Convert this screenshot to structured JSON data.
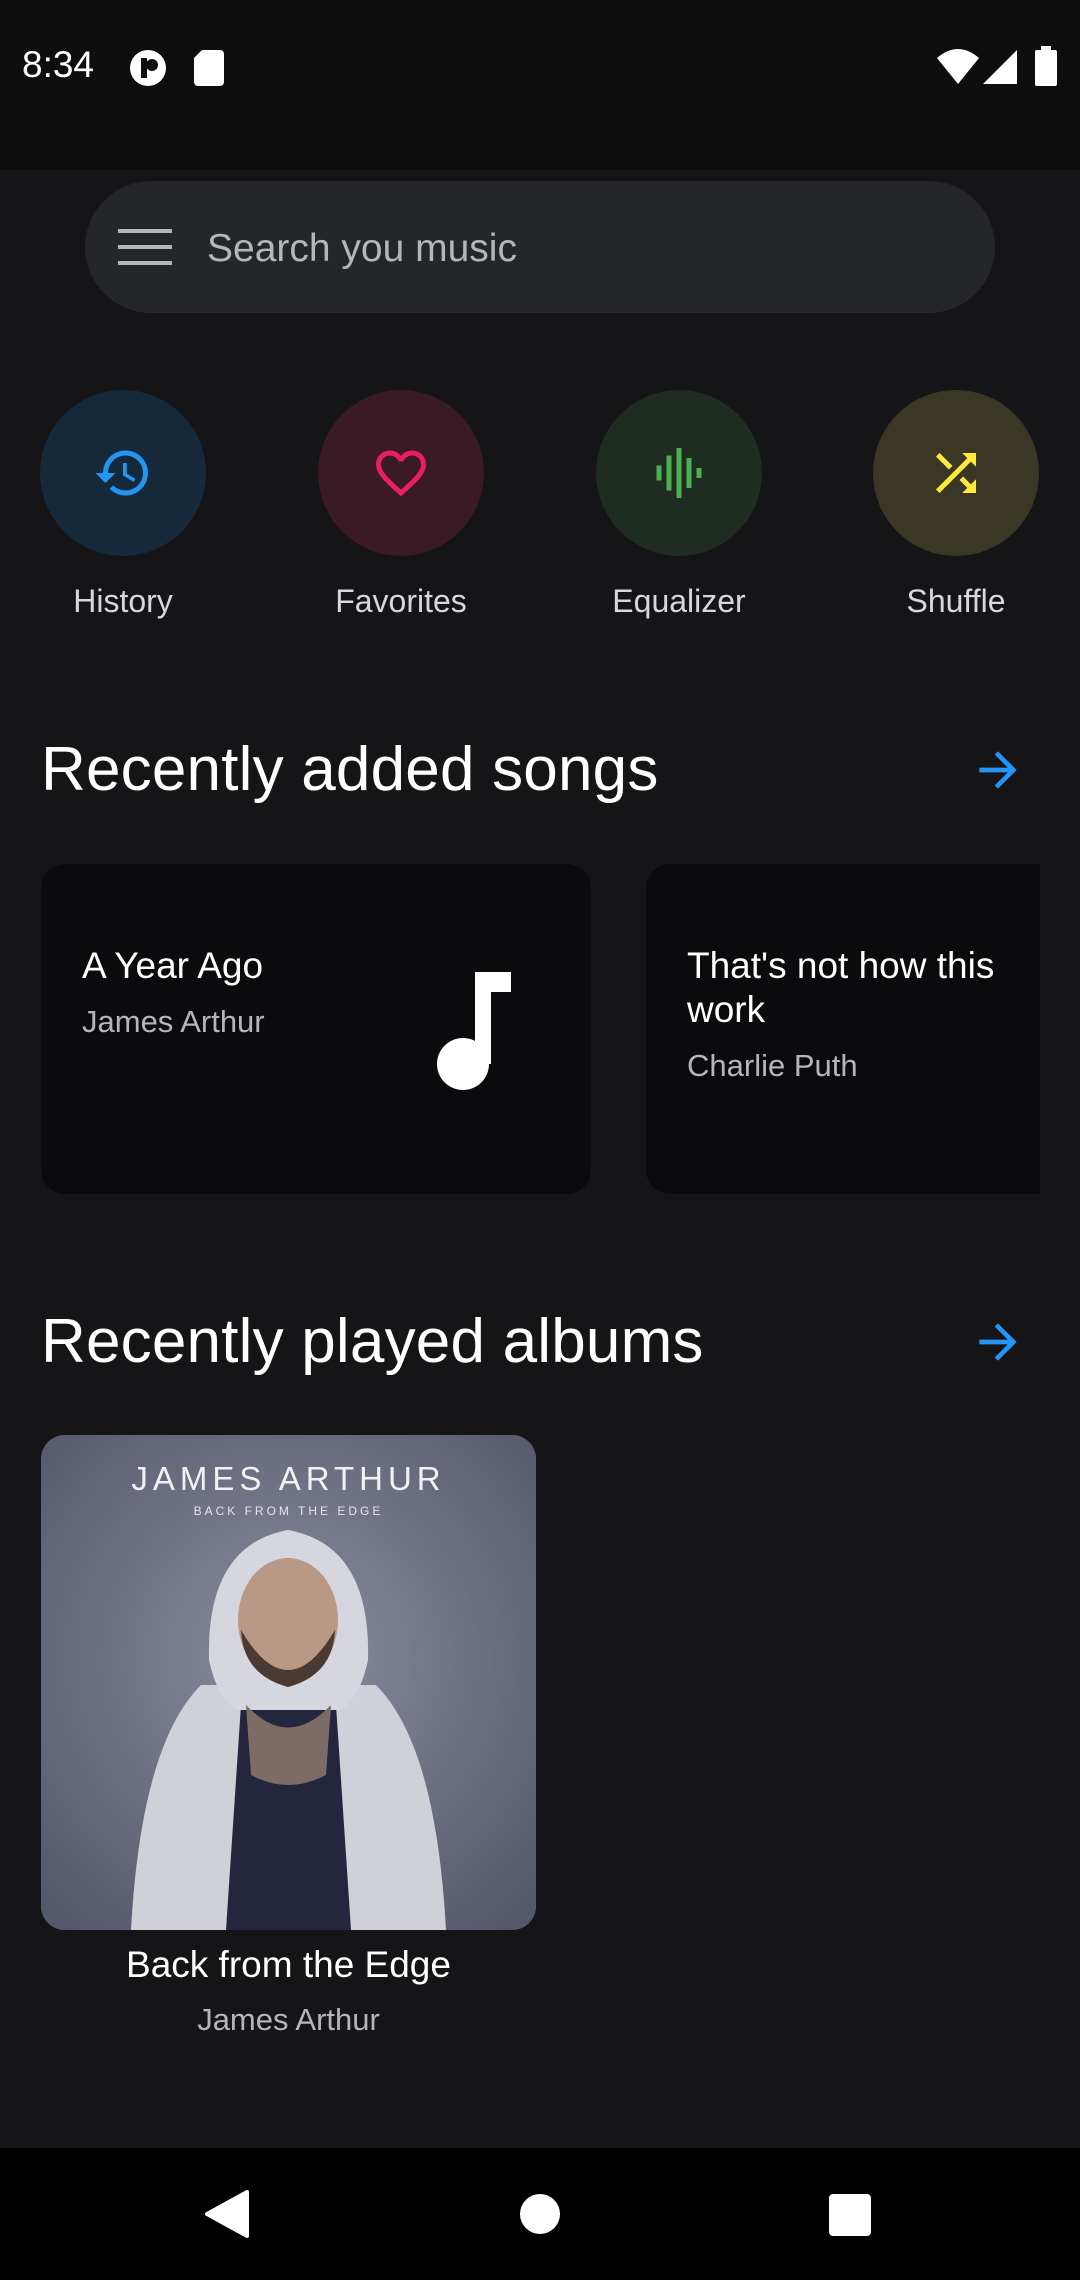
{
  "status_bar": {
    "time": "8:34"
  },
  "search": {
    "placeholder": "Search you music"
  },
  "quick_actions": [
    {
      "label": "History",
      "icon": "history-icon",
      "color": "#2196f3",
      "bg": "#15293b"
    },
    {
      "label": "Favorites",
      "icon": "heart-icon",
      "color": "#e91e63",
      "bg": "#3a1a24"
    },
    {
      "label": "Equalizer",
      "icon": "equalizer-icon",
      "color": "#4caf50",
      "bg": "#1e2c22"
    },
    {
      "label": "Shuffle",
      "icon": "shuffle-icon",
      "color": "#ffeb3b",
      "bg": "#3a3824"
    }
  ],
  "recent_songs": {
    "title": "Recently added songs",
    "items": [
      {
        "title": "A Year Ago",
        "artist": "James Arthur"
      },
      {
        "title": "That's not how this work",
        "artist": "Charlie Puth"
      }
    ]
  },
  "recent_albums": {
    "title": "Recently played albums",
    "items": [
      {
        "title": "Back from the Edge",
        "artist": "James Arthur",
        "cover_title": "JAMES ARTHUR",
        "cover_subtitle": "BACK FROM THE EDGE"
      }
    ]
  },
  "colors": {
    "accent": "#2196f3",
    "background": "#151517",
    "card": "#0b0b0d"
  }
}
